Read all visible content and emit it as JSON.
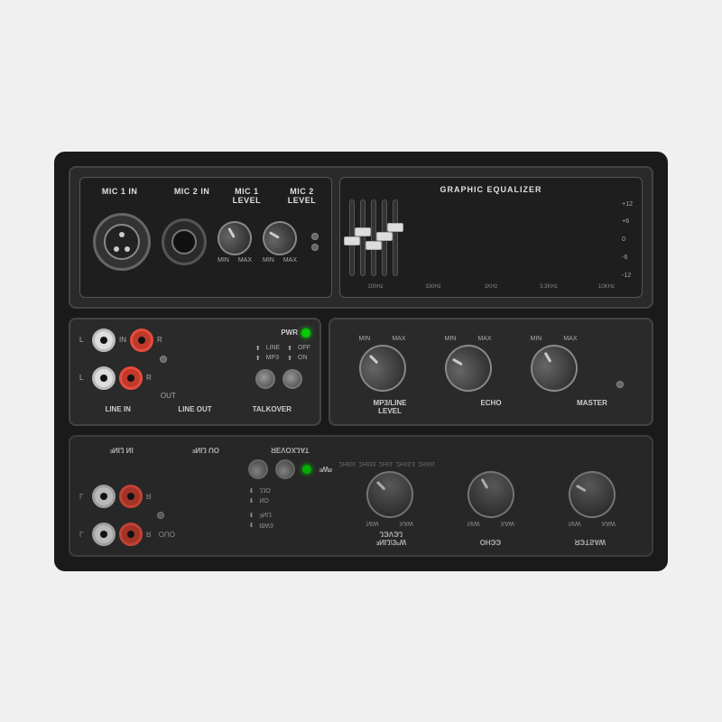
{
  "top_panel": {
    "mic1_in": "MIC 1 IN",
    "mic2_in": "MIC 2 IN",
    "mic1_level": "MIC 1\nLEVEL",
    "mic2_level": "MIC 2\nLEVEL",
    "eq_title": "GRAPHIC EQUALIZER",
    "eq_db_labels": [
      "+12",
      "+6",
      "0",
      "-6",
      "-12"
    ],
    "eq_freq_labels": [
      "100Hz",
      "330Hz",
      "1KHz",
      "3.3KHz",
      "10KHz"
    ],
    "eq_sliders": [
      {
        "pos": 45,
        "freq": "100Hz"
      },
      {
        "pos": 35,
        "freq": "330Hz"
      },
      {
        "pos": 50,
        "freq": "1KHz"
      },
      {
        "pos": 40,
        "freq": "3.3KHz"
      },
      {
        "pos": 30,
        "freq": "10KHz"
      }
    ]
  },
  "middle_panel": {
    "in_label": "IN",
    "out_label": "OUT",
    "line_label_l": "L",
    "line_label_r": "R",
    "pwr_label": "PWR",
    "line_label": "LINE",
    "mp3_label": "MP3",
    "off_label": "OFF",
    "on_label": "ON",
    "bottom_labels": [
      "LINE IN",
      "LINE OUT",
      "TALKOVER"
    ],
    "controls_labels": [
      "MP3/LINE\nLEVEL",
      "ECHO",
      "MASTER"
    ],
    "min_label": "MIN",
    "max_label": "MAX"
  },
  "reflected_panel": {
    "labels": [
      "LINE IN",
      "LINE OUT",
      "TALKOVER",
      "MP3/LINE\nLEVEL",
      "ECHO",
      "MASTER"
    ],
    "eq_freq_labels": [
      "100Hz",
      "330Hz",
      "1KHz",
      "3.3KHz",
      "10KHz"
    ]
  }
}
